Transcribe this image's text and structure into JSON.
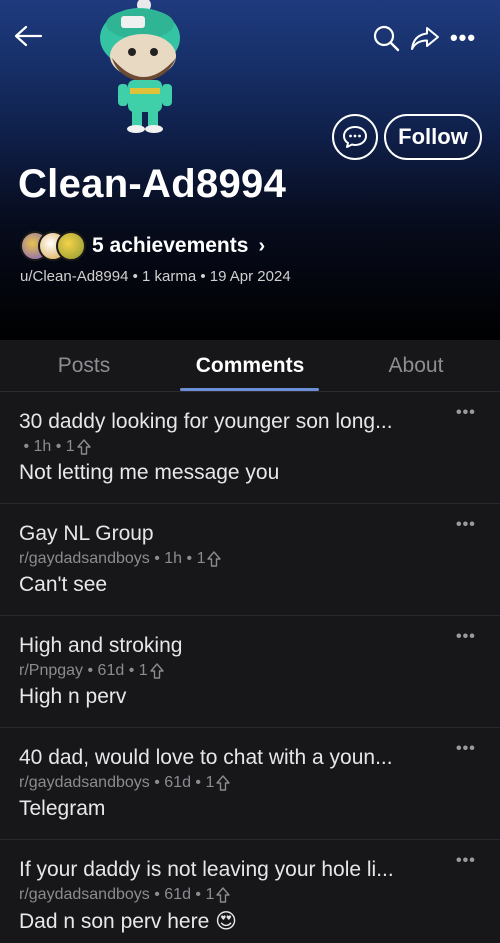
{
  "profile": {
    "username": "Clean-Ad8994",
    "follow_label": "Follow",
    "achievements_label": "5 achievements",
    "meta": "u/Clean-Ad8994 • 1 karma • 19 Apr 2024"
  },
  "tabs": {
    "posts": "Posts",
    "comments": "Comments",
    "about": "About",
    "active": "Comments"
  },
  "comments": [
    {
      "title": "30 daddy looking for younger son long...",
      "subreddit": "",
      "age": "1h",
      "score": "1",
      "body": "Not letting me message you"
    },
    {
      "title": "Gay NL Group",
      "subreddit": "r/gaydadsandboys",
      "age": "1h",
      "score": "1",
      "body": "Can't see"
    },
    {
      "title": "High and stroking",
      "subreddit": "r/Pnpgay",
      "age": "61d",
      "score": "1",
      "body": "High n perv"
    },
    {
      "title": "40 dad, would love to chat with a youn...",
      "subreddit": "r/gaydadsandboys",
      "age": "61d",
      "score": "1",
      "body": "Telegram"
    },
    {
      "title": "If your daddy is not leaving your hole li...",
      "subreddit": "r/gaydadsandboys",
      "age": "61d",
      "score": "1",
      "body": "Dad n son perv here 😍"
    }
  ],
  "icons": {
    "back": "arrow-left-icon",
    "search": "search-icon",
    "share": "share-icon",
    "more": "more-horizontal-icon",
    "chat": "chat-icon",
    "upvote": "upvote-arrow-icon"
  },
  "colors": {
    "header_top": "#1f3b7e",
    "background": "#17171a",
    "tab_underline": "#6d8fd8"
  }
}
